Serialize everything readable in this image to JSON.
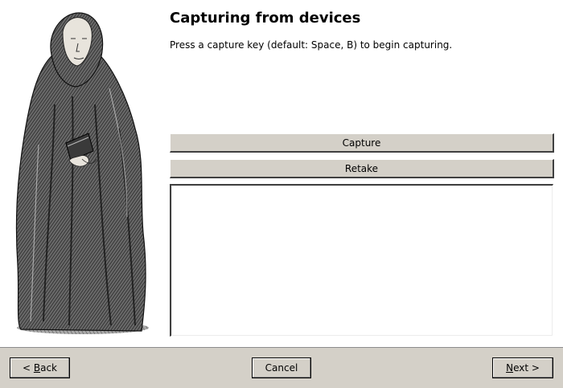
{
  "wizard": {
    "title": "Capturing from devices",
    "description": "Press a capture key (default: Space, B) to begin capturing."
  },
  "actions": {
    "capture_label": "Capture",
    "retake_label": "Retake"
  },
  "footer": {
    "back_prefix": "< ",
    "back_mnemonic": "B",
    "back_rest": "ack",
    "cancel_label": "Cancel",
    "next_mnemonic": "N",
    "next_rest": "ext >"
  },
  "illustration": {
    "icon": "monk-figure-engraving"
  }
}
